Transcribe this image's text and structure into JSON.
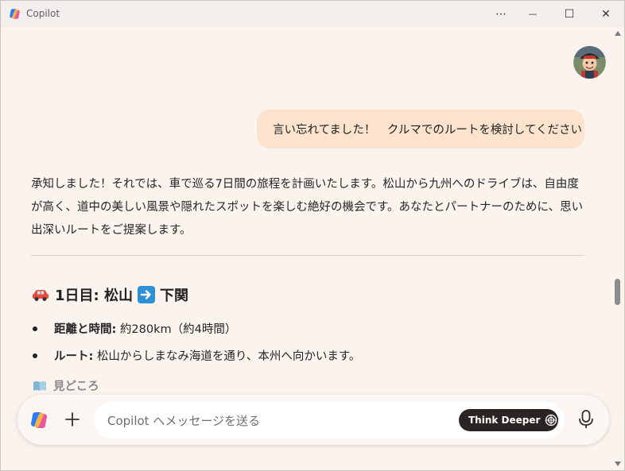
{
  "window": {
    "title": "Copilot",
    "more_glyph": "⋯",
    "minimize_glyph": "—",
    "maximize_glyph": "☐",
    "close_glyph": "✕"
  },
  "chat": {
    "user_message": "言い忘れてました！　クルマでのルートを検討してください",
    "response_intro": "承知しました！それでは、車で巡る7日間の旅程を計画いたします。松山から九州へのドライブは、自由度が高く、道中の美しい風景や隠れたスポットを楽しむ絶好の機会です。あなたとパートナーのために、思い出深いルートをご提案します。",
    "day1": {
      "title_from": "1日目: 松山",
      "title_to": "下関",
      "distance_label": "距離と時間:",
      "distance_value": " 約280km（約4時間）",
      "route_label": "ルート:",
      "route_value": " 松山からしまなみ海道を通り、本州へ向かいます。",
      "sights_label": "見どころ"
    }
  },
  "composer": {
    "placeholder": "Copilot へメッセージを送る",
    "think_deeper_label": "Think Deeper"
  },
  "colors": {
    "user_bubble": "#fbe3cd",
    "background": "#faf3ee",
    "think_button": "#2a2522"
  }
}
